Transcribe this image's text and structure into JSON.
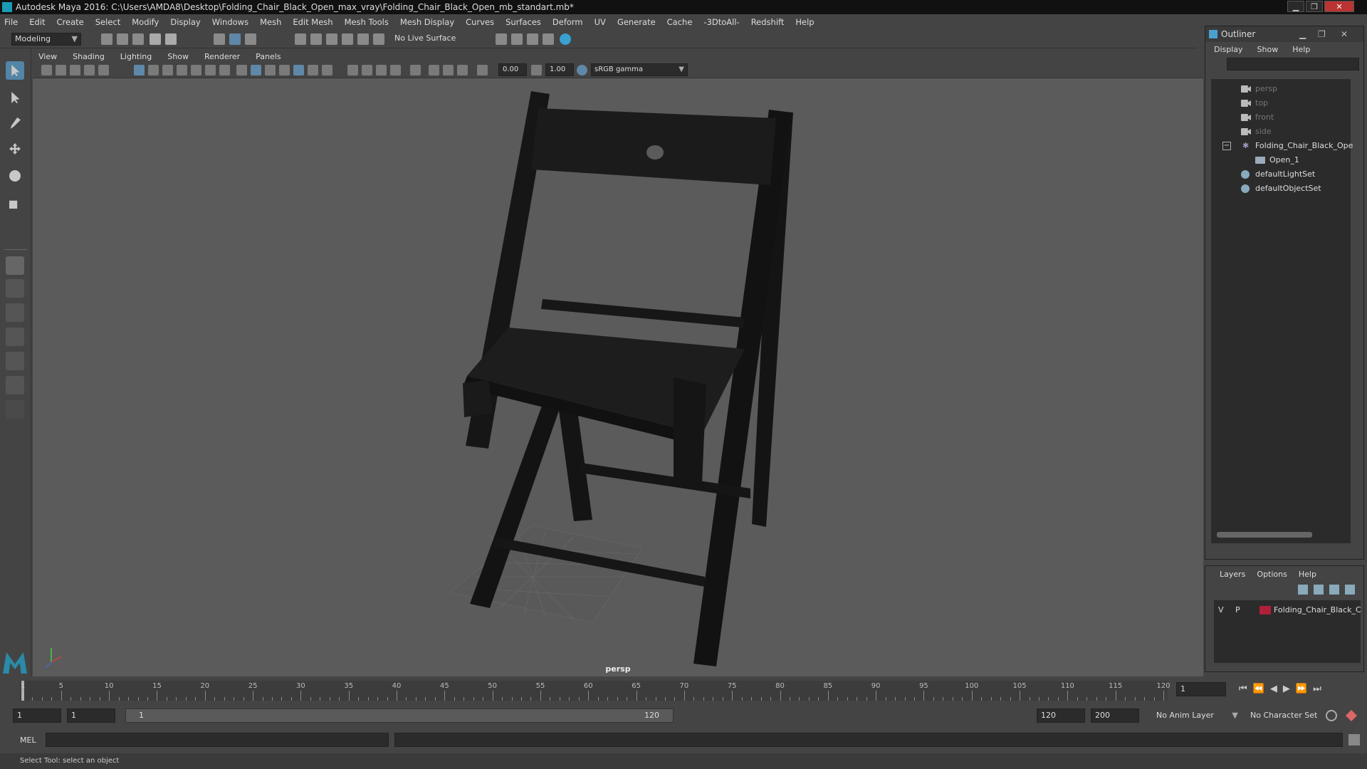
{
  "window": {
    "title": "Autodesk Maya 2016: C:\\Users\\AMDA8\\Desktop\\Folding_Chair_Black_Open_max_vray\\Folding_Chair_Black_Open_mb_standart.mb*"
  },
  "menubar": [
    "File",
    "Edit",
    "Create",
    "Select",
    "Modify",
    "Display",
    "Windows",
    "Mesh",
    "Edit Mesh",
    "Mesh Tools",
    "Mesh Display",
    "Curves",
    "Surfaces",
    "Deform",
    "UV",
    "Generate",
    "Cache",
    "-3DtoAll-",
    "Redshift",
    "Help"
  ],
  "toolbar": {
    "mode": "Modeling",
    "live_surface": "No Live Surface"
  },
  "viewport": {
    "menu": [
      "View",
      "Shading",
      "Lighting",
      "Show",
      "Renderer",
      "Panels"
    ],
    "exposure": "0.00",
    "gamma": "1.00",
    "color_space": "sRGB gamma",
    "camera_label": "persp"
  },
  "outliner": {
    "title": "Outliner",
    "menu": [
      "Display",
      "Show",
      "Help"
    ],
    "items": [
      {
        "label": "persp",
        "dim": true,
        "icon": "camera-icon"
      },
      {
        "label": "top",
        "dim": true,
        "icon": "camera-icon"
      },
      {
        "label": "front",
        "dim": true,
        "icon": "camera-icon"
      },
      {
        "label": "side",
        "dim": true,
        "icon": "camera-icon"
      },
      {
        "label": "Folding_Chair_Black_Ope",
        "dim": false,
        "icon": "group-icon"
      },
      {
        "label": "Open_1",
        "dim": false,
        "icon": "mesh-icon"
      },
      {
        "label": "defaultLightSet",
        "dim": false,
        "icon": "set-icon"
      },
      {
        "label": "defaultObjectSet",
        "dim": false,
        "icon": "set-icon"
      }
    ]
  },
  "layers": {
    "menu": [
      "Layers",
      "Options",
      "Help"
    ],
    "layer": {
      "v": "V",
      "p": "P",
      "name": "Folding_Chair_Black_C",
      "color": "#b0203a"
    }
  },
  "timeline": {
    "ticks": [
      "1",
      "5",
      "10",
      "15",
      "20",
      "25",
      "30",
      "35",
      "40",
      "45",
      "50",
      "55",
      "60",
      "65",
      "70",
      "75",
      "80",
      "85",
      "90",
      "95",
      "100",
      "105",
      "110",
      "115",
      "120"
    ],
    "current_frame": "1"
  },
  "range": {
    "start": "1",
    "anim_start": "1",
    "slider_start": "1",
    "slider_end": "120",
    "anim_end": "120",
    "end": "200",
    "anim_layer": "No Anim Layer",
    "character_set": "No Character Set"
  },
  "command": {
    "label": "MEL"
  },
  "help_line": "Select Tool: select an object"
}
